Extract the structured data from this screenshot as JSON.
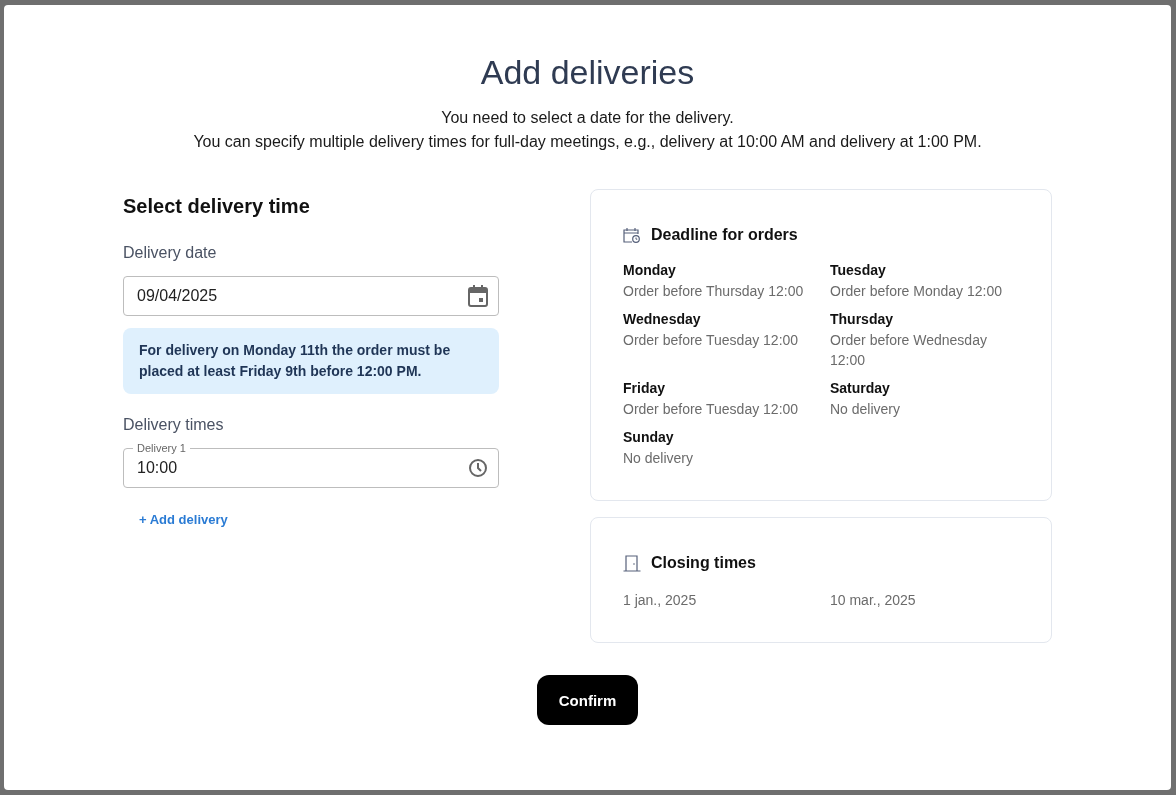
{
  "dialog": {
    "title": "Add deliveries",
    "intro": [
      "You need to select a date for the delivery.",
      "You can specify multiple delivery times for full-day meetings, e.g., delivery at 10:00 AM and delivery at 1:00 PM."
    ]
  },
  "form": {
    "heading": "Select delivery time",
    "date_label": "Delivery date",
    "date_value": "09/04/2025",
    "notice": "For delivery on Monday 11th the order must be placed at least Friday 9th before 12:00 PM.",
    "times_label": "Delivery times",
    "times": [
      {
        "label": "Delivery 1",
        "value": "10:00"
      }
    ],
    "add_link": "+ Add delivery"
  },
  "deadlines": {
    "title": "Deadline for orders",
    "items": [
      {
        "day": "Monday",
        "rule": "Order before Thursday 12:00"
      },
      {
        "day": "Tuesday",
        "rule": "Order before Monday 12:00"
      },
      {
        "day": "Wednesday",
        "rule": "Order before Tuesday 12:00"
      },
      {
        "day": "Thursday",
        "rule": "Order before Wednesday 12:00"
      },
      {
        "day": "Friday",
        "rule": "Order before Tuesday 12:00"
      },
      {
        "day": "Saturday",
        "rule": "No delivery"
      },
      {
        "day": "Sunday",
        "rule": "No delivery"
      }
    ]
  },
  "closing": {
    "title": "Closing times",
    "dates": [
      "1 jan., 2025",
      "10 mar., 2025"
    ]
  },
  "confirm_button": "Confirm"
}
